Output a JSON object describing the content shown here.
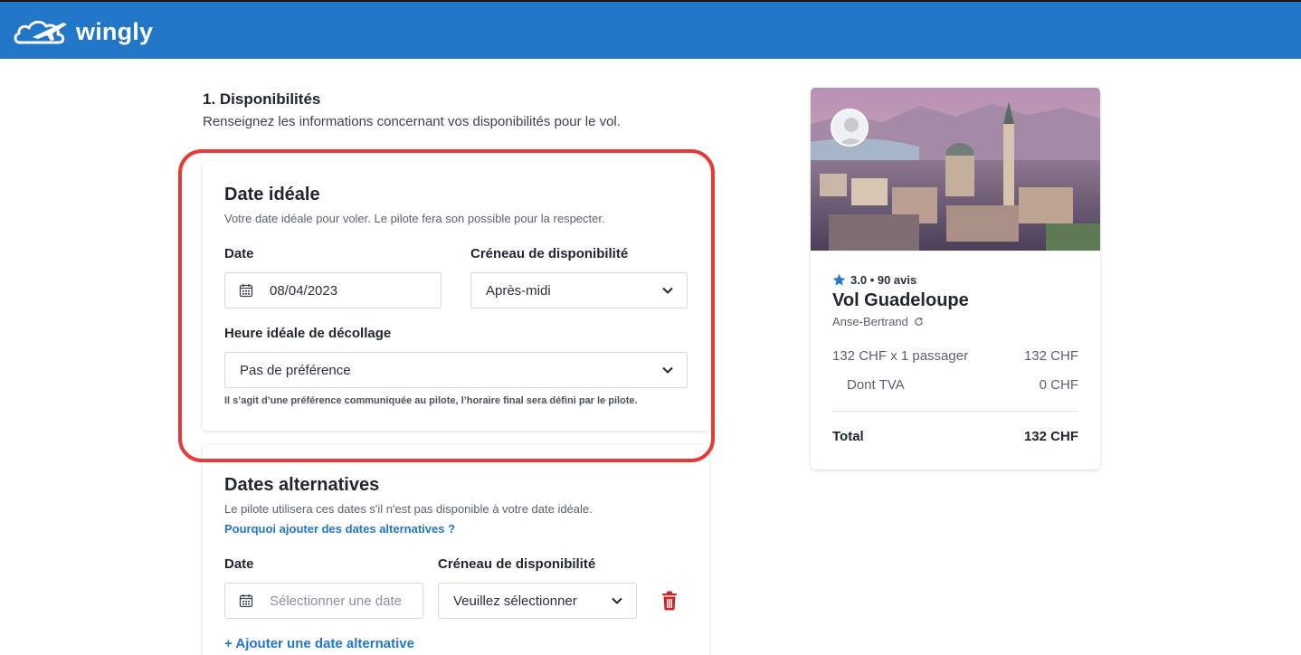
{
  "header": {
    "brand": "wingly",
    "logo_icon": "wingly-cloud-plane-logo",
    "color": "#2176c7"
  },
  "availability": {
    "title": "1. Disponibilités",
    "subtitle": "Renseignez les informations concernant vos disponibilités pour le vol."
  },
  "ideal_date": {
    "title": "Date idéale",
    "description": "Votre date idéale pour voler. Le pilote fera son possible pour la respecter.",
    "date_label": "Date",
    "date_value": "08/04/2023",
    "slot_label": "Créneau de disponibilité",
    "slot_value": "Après-midi",
    "time_label": "Heure idéale de décollage",
    "time_value": "Pas de préférence",
    "hint": "Il s’agit d’une préférence communiquée au pilote, l’horaire final sera défini par le pilote.",
    "highlight_color": "#e53a35"
  },
  "alternative_dates": {
    "title": "Dates alternatives",
    "description": "Le pilote utilisera ces dates s'il n'est pas disponible à votre date idéale.",
    "why_link": "Pourquoi ajouter des dates alternatives ?",
    "date_label": "Date",
    "date_placeholder": "Sélectionner une date",
    "slot_label": "Créneau de disponibilité",
    "slot_value": "Veuillez sélectionner",
    "add_link": "+ Ajouter une date alternative",
    "delete_icon": "trash-icon",
    "delete_color": "#c62828"
  },
  "summary": {
    "rating": "3.0",
    "reviews": "90 avis",
    "title": "Vol Guadeloupe",
    "location": "Anse-Bertrand",
    "lines": [
      {
        "label": "132 CHF x 1 passager",
        "value": "132 CHF"
      },
      {
        "label": "Dont TVA",
        "value": "0 CHF"
      }
    ],
    "total_label": "Total",
    "total_value": "132 CHF",
    "star_color": "#2176c7"
  }
}
